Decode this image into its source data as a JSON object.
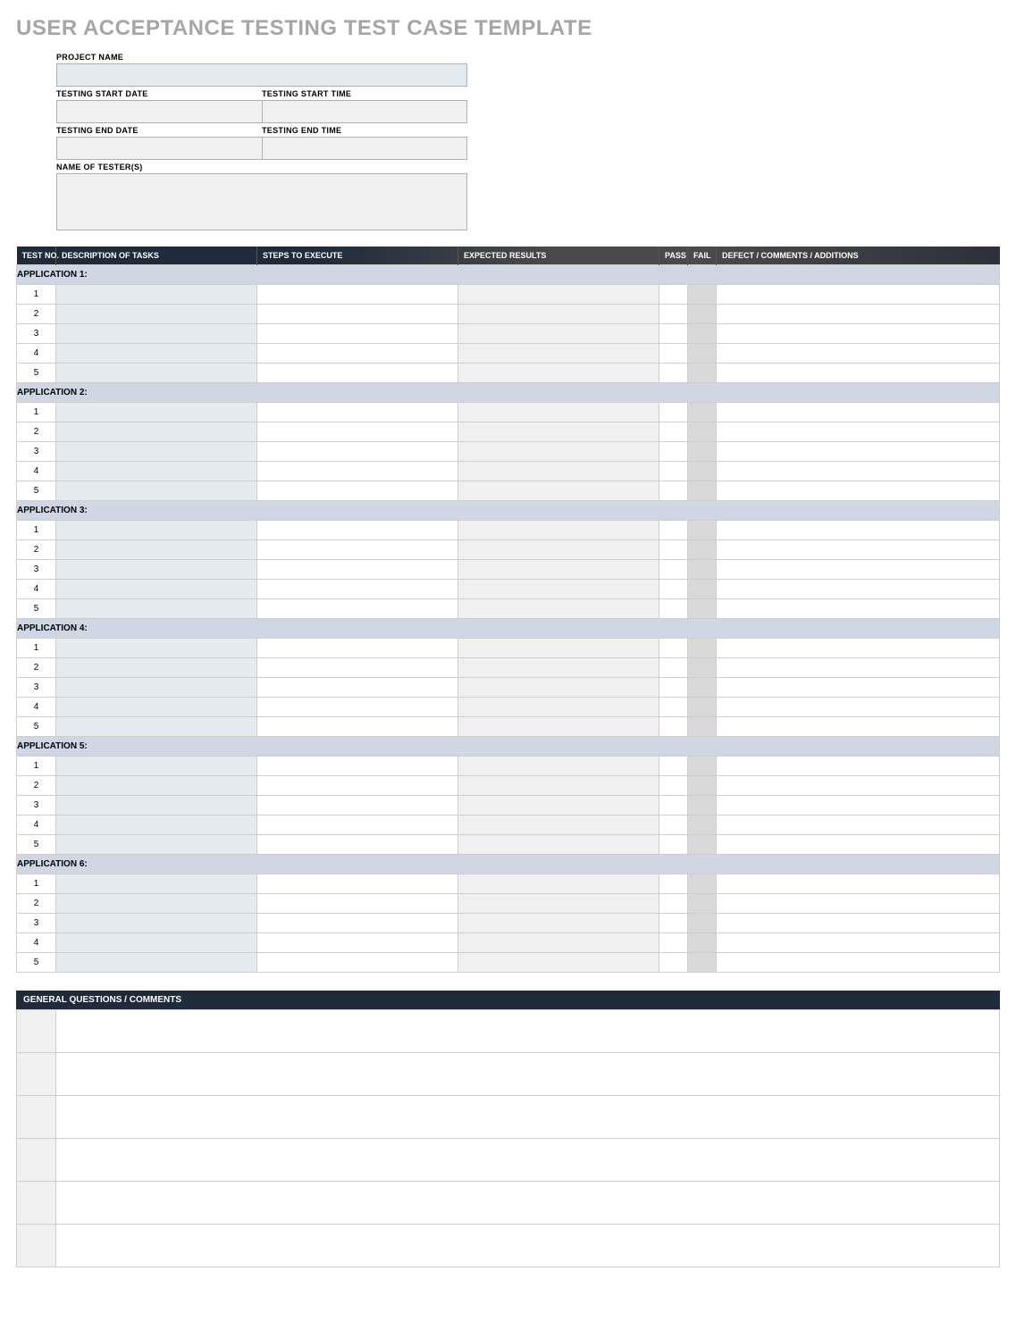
{
  "title": "USER ACCEPTANCE TESTING TEST CASE TEMPLATE",
  "info": {
    "project_label": "PROJECT NAME",
    "project_value": "",
    "start_date_label": "TESTING START DATE",
    "start_date_value": "",
    "start_time_label": "TESTING START TIME",
    "start_time_value": "",
    "end_date_label": "TESTING END DATE",
    "end_date_value": "",
    "end_time_label": "TESTING END TIME",
    "end_time_value": "",
    "tester_label": "NAME OF TESTER(S)",
    "tester_value": ""
  },
  "columns": {
    "test_no": "TEST NO.",
    "description": "DESCRIPTION OF TASKS",
    "steps": "STEPS TO EXECUTE",
    "expected": "EXPECTED RESULTS",
    "pass": "PASS",
    "fail": "FAIL",
    "defect": "DEFECT / COMMENTS / ADDITIONS"
  },
  "applications": [
    {
      "header": "APPLICATION 1:",
      "rows": [
        "1",
        "2",
        "3",
        "4",
        "5"
      ]
    },
    {
      "header": "APPLICATION 2:",
      "rows": [
        "1",
        "2",
        "3",
        "4",
        "5"
      ]
    },
    {
      "header": "APPLICATION 3:",
      "rows": [
        "1",
        "2",
        "3",
        "4",
        "5"
      ]
    },
    {
      "header": "APPLICATION 4:",
      "rows": [
        "1",
        "2",
        "3",
        "4",
        "5"
      ]
    },
    {
      "header": "APPLICATION 5:",
      "rows": [
        "1",
        "2",
        "3",
        "4",
        "5"
      ]
    },
    {
      "header": "APPLICATION 6:",
      "rows": [
        "1",
        "2",
        "3",
        "4",
        "5"
      ]
    }
  ],
  "comments": {
    "header": "GENERAL QUESTIONS / COMMENTS",
    "rows": 6
  }
}
